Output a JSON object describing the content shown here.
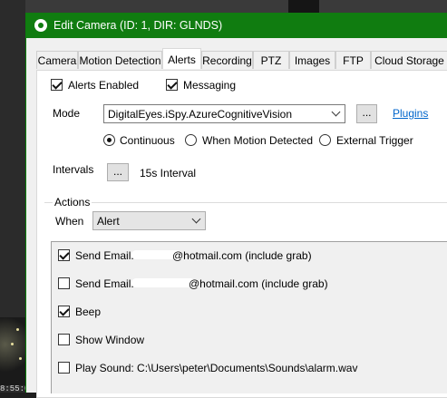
{
  "window": {
    "title": "Edit Camera (ID: 1, DIR: GLNDS)"
  },
  "tabs": [
    {
      "label": "Camera",
      "active": false
    },
    {
      "label": "Motion Detection",
      "active": false
    },
    {
      "label": "Alerts",
      "active": true
    },
    {
      "label": "Recording",
      "active": false
    },
    {
      "label": "PTZ",
      "active": false
    },
    {
      "label": "Images",
      "active": false
    },
    {
      "label": "FTP",
      "active": false
    },
    {
      "label": "Cloud Storage",
      "active": false
    }
  ],
  "alerts": {
    "alerts_enabled": {
      "label": "Alerts Enabled",
      "checked": true
    },
    "messaging": {
      "label": "Messaging",
      "checked": true
    },
    "mode_label": "Mode",
    "mode_value": "DigitalEyes.iSpy.AzureCognitiveVision",
    "mode_browse_label": "...",
    "plugins_link": "Plugins",
    "trigger_options": [
      {
        "label": "Continuous",
        "selected": true
      },
      {
        "label": "When Motion Detected",
        "selected": false
      },
      {
        "label": "External Trigger",
        "selected": false
      }
    ],
    "intervals_label": "Intervals",
    "intervals_button": "...",
    "interval_value": "15s Interval"
  },
  "actions": {
    "group_title": "Actions",
    "when_label": "When",
    "when_value": "Alert",
    "items": [
      {
        "prefix": "Send Email:",
        "suffix": "@hotmail.com (include grab)",
        "checked": true
      },
      {
        "prefix": "Send Email:",
        "suffix": "@hotmail.com (include grab)",
        "checked": false
      },
      {
        "prefix": "Beep",
        "suffix": "",
        "checked": true
      },
      {
        "prefix": "Show Window",
        "suffix": "",
        "checked": false
      },
      {
        "prefix": "Play Sound: C:\\Users\\peter\\Documents\\Sounds\\alarm.wav",
        "suffix": "",
        "checked": false
      }
    ]
  },
  "background": {
    "timestamp": "8:55:0"
  },
  "colors": {
    "titlebar": "#107c10",
    "link": "#0066cc"
  }
}
